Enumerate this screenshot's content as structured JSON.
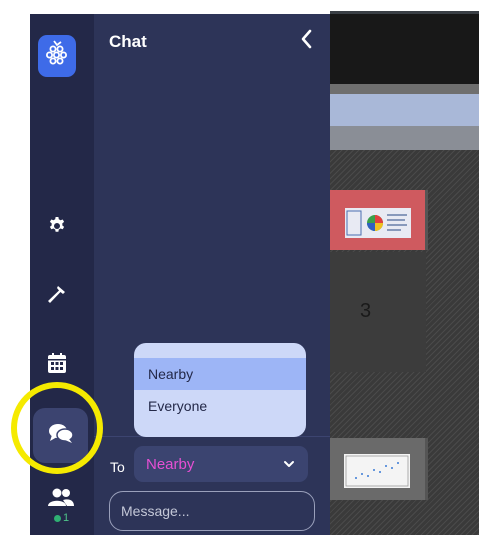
{
  "chat_panel": {
    "title": "Chat",
    "to_label": "To",
    "recipient_selected": "Nearby",
    "message_placeholder": "Message..."
  },
  "recipient_dropdown": {
    "options": [
      "Nearby",
      "Everyone"
    ],
    "selected_index": 0
  },
  "sidebar": {
    "items": [
      {
        "icon": "settings-gear-icon"
      },
      {
        "icon": "hammer-build-icon"
      },
      {
        "icon": "calendar-icon"
      },
      {
        "icon": "chat-bubbles-icon",
        "active": true
      },
      {
        "icon": "users-icon"
      }
    ],
    "online_users_count": "1"
  },
  "map": {
    "room_number": "3"
  },
  "colors": {
    "rail_bg": "#232848",
    "panel_bg": "#2d3458",
    "logo_blue": "#3e6be8",
    "accent_pink": "#e64fd4",
    "highlight_yellow": "#f5ea00",
    "dropdown_bg": "#cdd8f8",
    "dropdown_selected": "#9db5f6"
  }
}
